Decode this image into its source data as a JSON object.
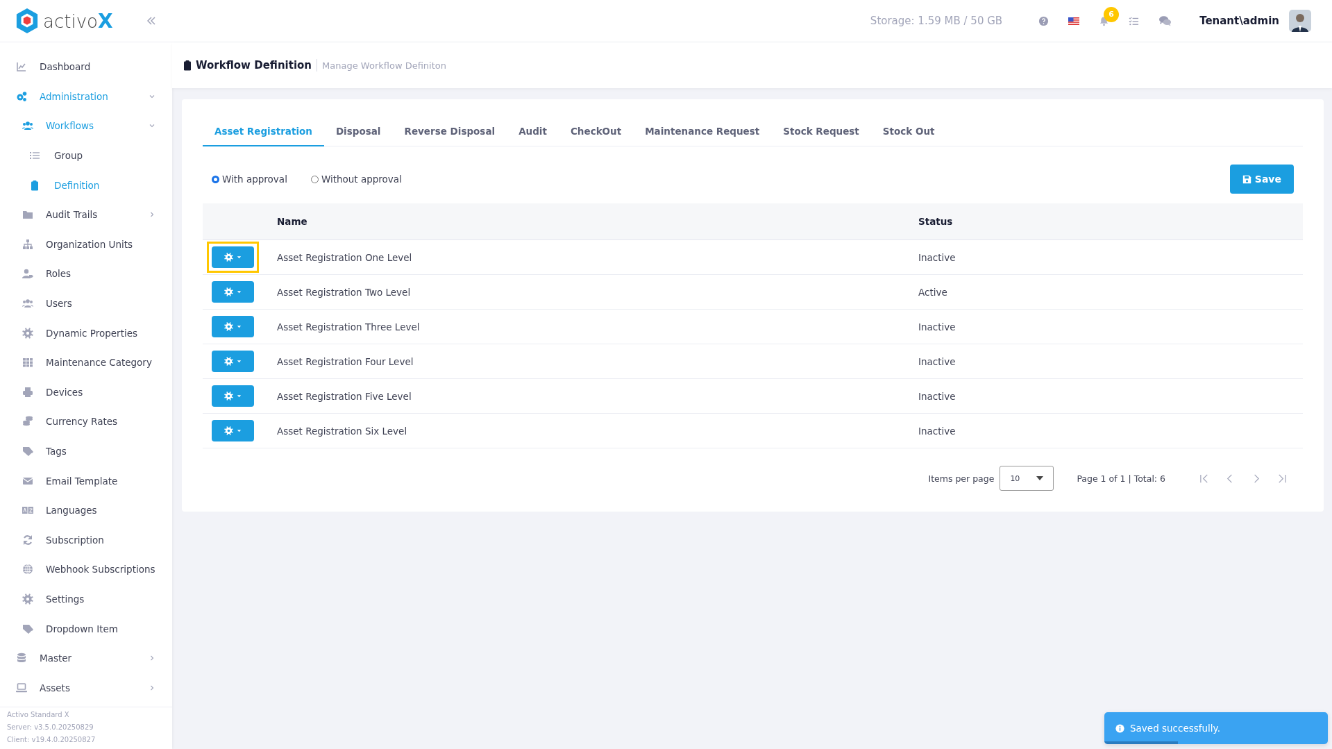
{
  "app": {
    "logo_text": "activo",
    "logo_mark": "X"
  },
  "header": {
    "storage": "Storage: 1.59 MB / 50 GB",
    "notification_count": "6",
    "user": "Tenant\\admin"
  },
  "sidebar": {
    "items": [
      {
        "label": "Dashboard",
        "selected": false
      },
      {
        "label": "Administration",
        "selected": true,
        "expanded": true,
        "children": [
          {
            "label": "Workflows",
            "selected": true,
            "expanded": true,
            "children": [
              {
                "label": "Group",
                "selected": false
              },
              {
                "label": "Definition",
                "selected": true
              }
            ]
          },
          {
            "label": "Audit Trails",
            "selected": false,
            "expanded": false
          },
          {
            "label": "Organization Units",
            "selected": false
          },
          {
            "label": "Roles",
            "selected": false
          },
          {
            "label": "Users",
            "selected": false
          },
          {
            "label": "Dynamic Properties",
            "selected": false
          },
          {
            "label": "Maintenance Category",
            "selected": false
          },
          {
            "label": "Devices",
            "selected": false
          },
          {
            "label": "Currency Rates",
            "selected": false
          },
          {
            "label": "Tags",
            "selected": false
          },
          {
            "label": "Email Template",
            "selected": false
          },
          {
            "label": "Languages",
            "selected": false
          },
          {
            "label": "Subscription",
            "selected": false
          },
          {
            "label": "Webhook Subscriptions",
            "selected": false
          },
          {
            "label": "Settings",
            "selected": false
          },
          {
            "label": "Dropdown Item",
            "selected": false
          }
        ]
      },
      {
        "label": "Master",
        "selected": false,
        "expanded": false
      },
      {
        "label": "Assets",
        "selected": false,
        "expanded": false
      }
    ],
    "footer": [
      "Activo Standard X",
      "Server: v3.5.0.20250829",
      "Client: v19.4.0.20250827"
    ]
  },
  "page": {
    "title": "Workflow Definition",
    "subtitle": "Manage Workflow Definiton"
  },
  "tabs": [
    {
      "label": "Asset Registration",
      "selected": true
    },
    {
      "label": "Disposal",
      "selected": false
    },
    {
      "label": "Reverse Disposal",
      "selected": false
    },
    {
      "label": "Audit",
      "selected": false
    },
    {
      "label": "CheckOut",
      "selected": false
    },
    {
      "label": "Maintenance Request",
      "selected": false
    },
    {
      "label": "Stock Request",
      "selected": false
    },
    {
      "label": "Stock Out",
      "selected": false
    }
  ],
  "approval_options": [
    {
      "label": "With approval",
      "selected": true
    },
    {
      "label": "Without approval",
      "selected": false
    }
  ],
  "save_button": "Save",
  "table": {
    "columns": [
      "Name",
      "Status"
    ],
    "rows": [
      {
        "name": "Asset Registration One Level",
        "status": "Inactive",
        "highlighted": true
      },
      {
        "name": "Asset Registration Two Level",
        "status": "Active",
        "highlighted": false
      },
      {
        "name": "Asset Registration Three Level",
        "status": "Inactive",
        "highlighted": false
      },
      {
        "name": "Asset Registration Four Level",
        "status": "Inactive",
        "highlighted": false
      },
      {
        "name": "Asset Registration Five Level",
        "status": "Inactive",
        "highlighted": false
      },
      {
        "name": "Asset Registration Six Level",
        "status": "Inactive",
        "highlighted": false
      }
    ]
  },
  "pagination": {
    "items_per_page_label": "Items per page",
    "page_size": "10",
    "summary": "Page 1 of 1 | Total: 6"
  },
  "toast": {
    "message": "Saved successfully.",
    "level": 0.33
  }
}
